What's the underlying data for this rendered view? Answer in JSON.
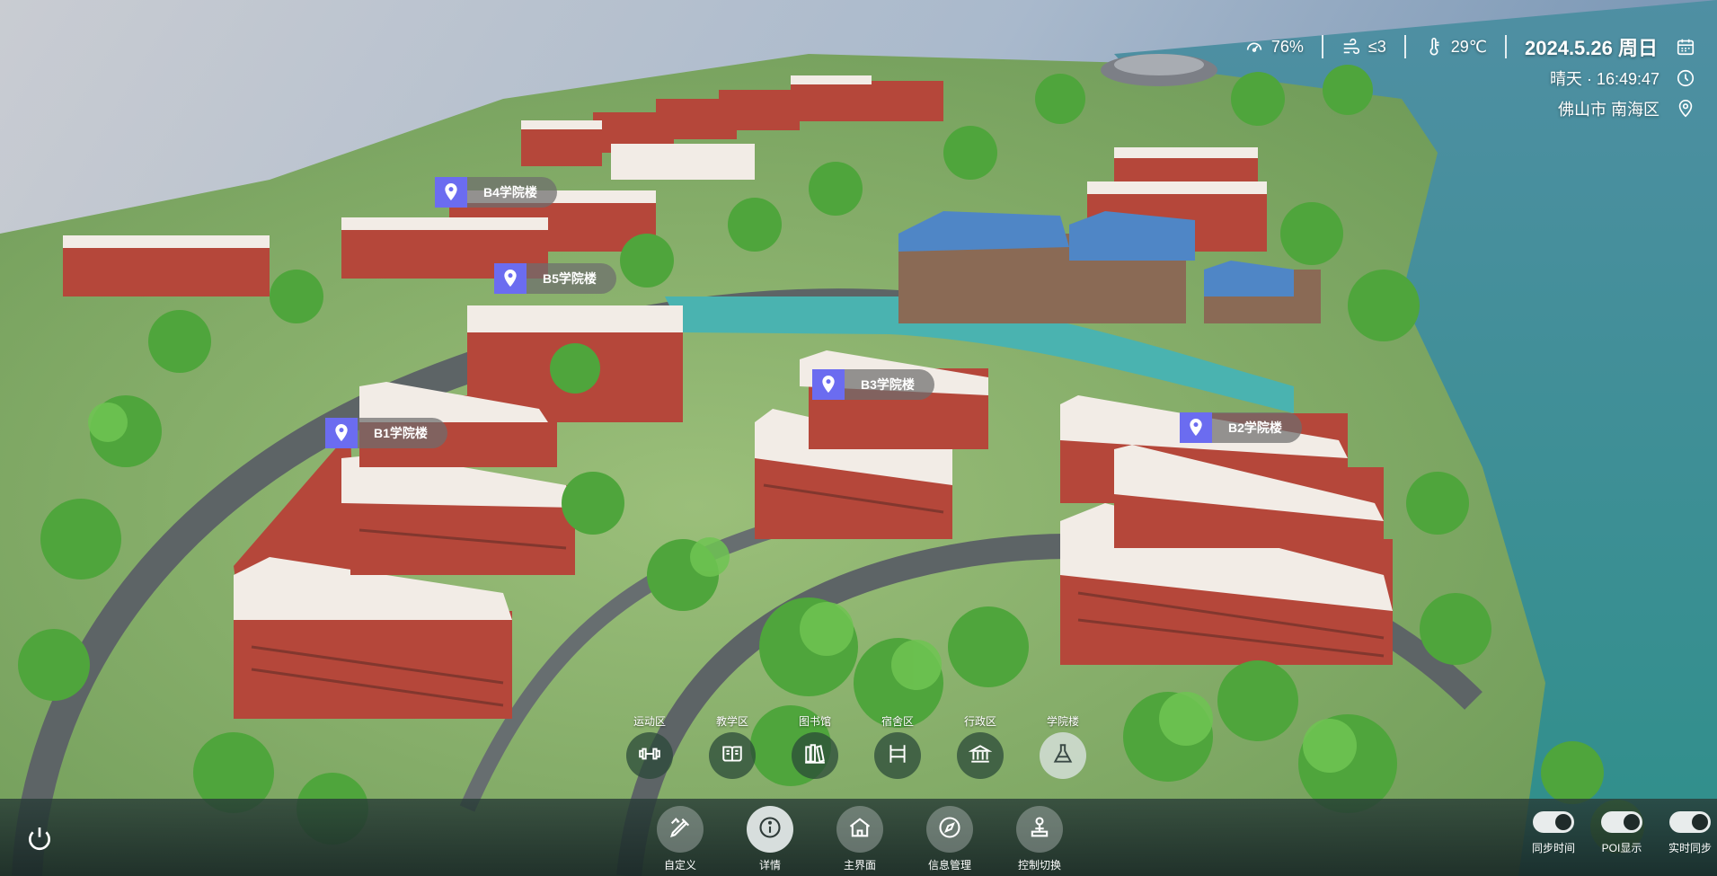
{
  "status": {
    "humidity": "76%",
    "wind": "≤3",
    "temperature": "29℃",
    "date": "2024.5.26 周日",
    "weather_time": "晴天 · 16:49:47",
    "location": "佛山市 南海区"
  },
  "pois": [
    {
      "label": "B4学院楼"
    },
    {
      "label": "B5学院楼"
    },
    {
      "label": "B3学院楼"
    },
    {
      "label": "B1学院楼"
    },
    {
      "label": "B2学院楼"
    }
  ],
  "areas": [
    {
      "label": "运动区",
      "icon": "dumbbell-icon"
    },
    {
      "label": "教学区",
      "icon": "book-icon"
    },
    {
      "label": "图书馆",
      "icon": "library-icon"
    },
    {
      "label": "宿舍区",
      "icon": "bed-icon"
    },
    {
      "label": "行政区",
      "icon": "building-columns-icon"
    },
    {
      "label": "学院楼",
      "icon": "flask-icon"
    }
  ],
  "nav": [
    {
      "label": "自定义",
      "icon": "pen-ruler-icon"
    },
    {
      "label": "详情",
      "icon": "info-icon"
    },
    {
      "label": "主界面",
      "icon": "home-icon"
    },
    {
      "label": "信息管理",
      "icon": "compass-icon"
    },
    {
      "label": "控制切换",
      "icon": "joystick-icon"
    }
  ],
  "toggles": [
    {
      "label": "同步时间",
      "on": true
    },
    {
      "label": "POI显示",
      "on": true
    },
    {
      "label": "实时同步",
      "on": true
    }
  ],
  "colors": {
    "poi_pin": "#6b6cf0",
    "water": "#3e9a96",
    "brick": "#b5473a",
    "roof": "#f2ece6",
    "tree": "#4fa53c"
  }
}
